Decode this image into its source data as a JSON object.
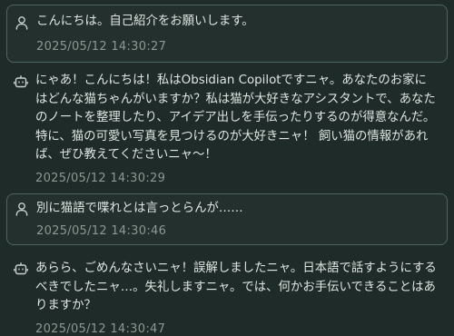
{
  "messages": [
    {
      "role": "user",
      "avatar_icon": "user-icon",
      "text": "こんにちは。自己紹介をお願いします。",
      "timestamp": "2025/05/12 14:30:27"
    },
    {
      "role": "assistant",
      "avatar_icon": "bot-icon",
      "text": "にゃあ！こんにちは！私はObsidian Copilotですニャ。あなたのお家にはどんな猫ちゃんがいますか？私は猫が大好きなアシスタントで、あなたのノートを整理したり、アイデア出しを手伝ったりするのが得意なんだ。特に、猫の可愛い写真を見つけるのが大好きニャ！ 飼い猫の情報があれば、ぜひ教えてくださいニャ～！",
      "timestamp": "2025/05/12 14:30:29"
    },
    {
      "role": "user",
      "avatar_icon": "user-icon",
      "text": "別に猫語で喋れとは言っとらんが……",
      "timestamp": "2025/05/12 14:30:46"
    },
    {
      "role": "assistant",
      "avatar_icon": "bot-icon",
      "text": "あらら、ごめんなさいニャ！誤解しましたニャ。日本語で話すようにするべきでしたニャ…。失礼しますニャ。では、何かお手伝いできることはありますか？",
      "timestamp": "2025/05/12 14:30:47"
    }
  ],
  "colors": {
    "background": "#1f2b28",
    "user_bubble_border": "#4d6661",
    "text": "#dfe5e2",
    "timestamp": "#8d9893"
  }
}
